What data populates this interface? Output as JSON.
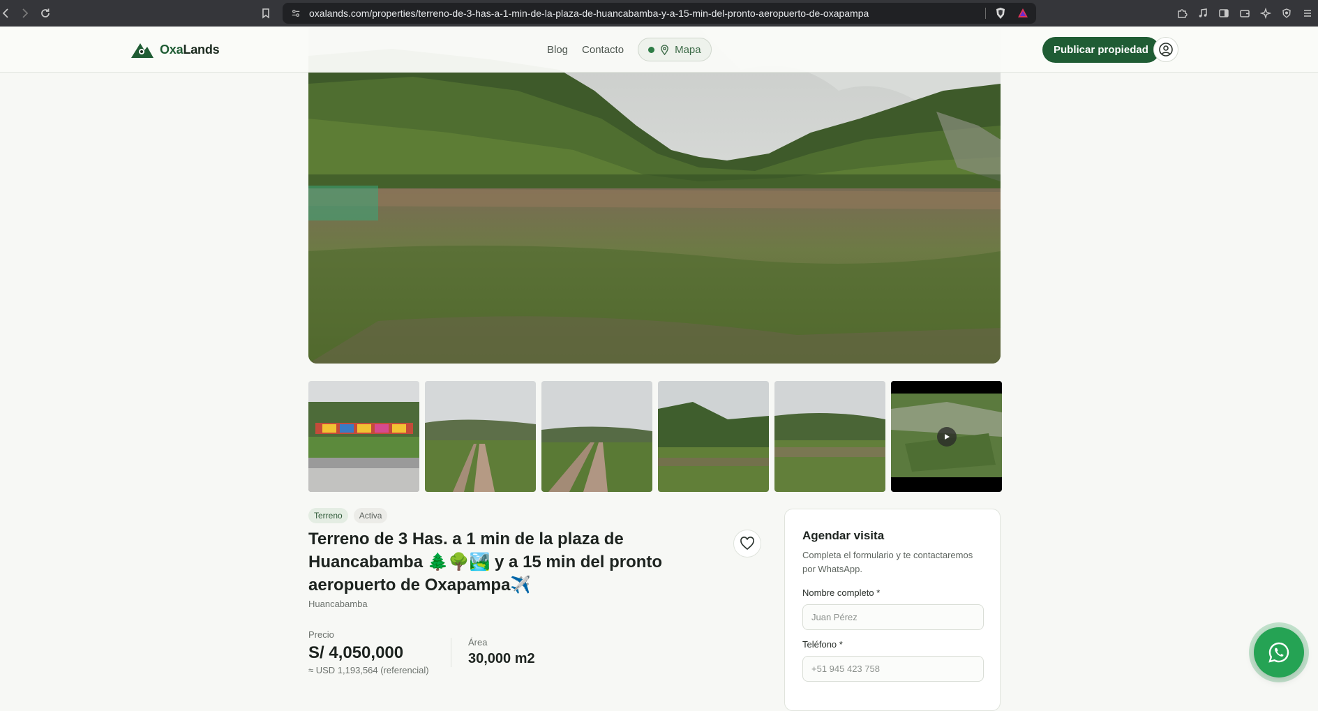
{
  "browser": {
    "url": "oxalands.com/properties/terreno-de-3-has-a-1-min-de-la-plaza-de-huancabamba-y-a-15-min-del-pronto-aeropuerto-de-oxapampa"
  },
  "header": {
    "logo_prefix": "Oxa",
    "logo_suffix": "Lands",
    "nav": {
      "blog": "Blog",
      "contact": "Contacto",
      "map": "Mapa"
    },
    "publish_label": "Publicar propiedad"
  },
  "gallery": {
    "thumbnails": [
      {
        "kind": "photo",
        "icon": "plaza-sign"
      },
      {
        "kind": "photo",
        "icon": "dirt-road"
      },
      {
        "kind": "photo",
        "icon": "dirt-road"
      },
      {
        "kind": "photo",
        "icon": "field-mountains"
      },
      {
        "kind": "photo",
        "icon": "field-trees"
      },
      {
        "kind": "video",
        "icon": "play-icon"
      }
    ]
  },
  "property": {
    "badges": {
      "type": "Terreno",
      "status": "Activa"
    },
    "title": "Terreno de 3 Has. a 1 min de la plaza de Huancabamba 🌲🌳🏞️ y a 15 min del pronto aeropuerto de Oxapampa✈️",
    "location": "Huancabamba",
    "price_label": "Precio",
    "price": "S/ 4,050,000",
    "usd": "≈ USD 1,193,564 (referencial)",
    "area_label": "Área",
    "area": "30,000 m2"
  },
  "visit_form": {
    "title": "Agendar visita",
    "description": "Completa el formulario y te contactaremos por WhatsApp.",
    "name_label": "Nombre completo *",
    "name_placeholder": "Juan Pérez",
    "phone_label": "Teléfono *",
    "phone_placeholder": "+51 945 423 758"
  },
  "colors": {
    "brand_green": "#1f5c34",
    "whatsapp_green": "#25a354",
    "page_bg": "#f7f8f5"
  }
}
